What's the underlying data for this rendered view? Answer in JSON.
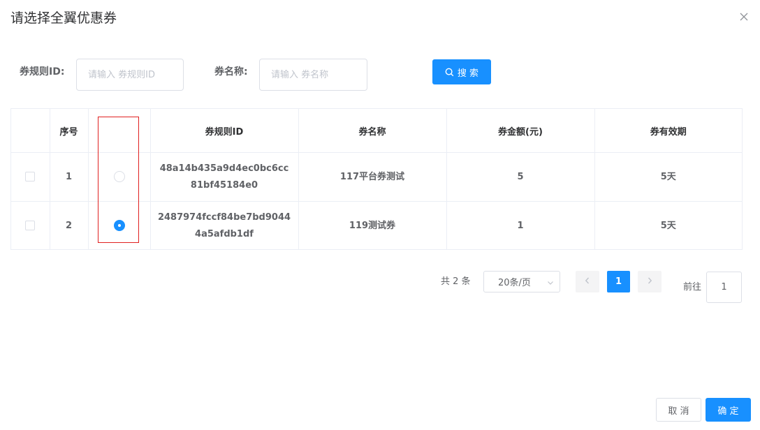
{
  "dialog": {
    "title": "请选择全翼优惠券"
  },
  "search": {
    "rule_id_label": "券规则ID:",
    "rule_id_placeholder": "请输入 券规则ID",
    "rule_id_value": "",
    "name_label": "券名称:",
    "name_placeholder": "请输入 券名称",
    "name_value": "",
    "button_label": "搜 索"
  },
  "table": {
    "columns": [
      "",
      "序号",
      "",
      "券规则ID",
      "券名称",
      "券金额(元)",
      "券有效期"
    ],
    "rows": [
      {
        "checked": false,
        "selected": false,
        "index": "1",
        "rule_id": "48a14b435a9d4ec0bc6cc81bf45184e0",
        "name": "117平台券测试",
        "amount": "5",
        "validity": "5天"
      },
      {
        "checked": false,
        "selected": true,
        "index": "2",
        "rule_id": "2487974fccf84be7bd90444a5afdb1df",
        "name": "119测试券",
        "amount": "1",
        "validity": "5天"
      }
    ]
  },
  "pagination": {
    "total_text": "共 2 条",
    "page_size": "20条/页",
    "current_page": "1",
    "goto_label": "前往",
    "goto_value": "1"
  },
  "footer": {
    "cancel_label": "取 消",
    "ok_label": "确 定"
  },
  "colors": {
    "primary": "#1890ff",
    "highlight": "#e02020",
    "border": "#dcdfe6"
  },
  "icons": {
    "close": "close-icon",
    "search": "search-icon",
    "prev": "chevron-left-icon",
    "next": "chevron-right-icon",
    "dropdown": "chevron-down-icon"
  }
}
